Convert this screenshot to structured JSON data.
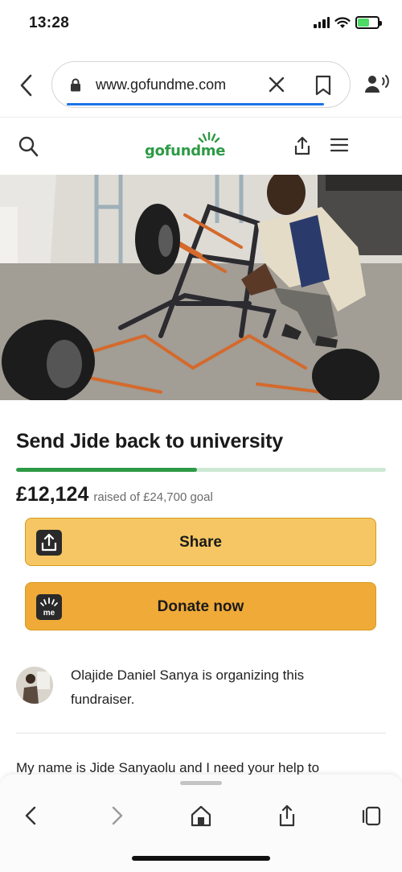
{
  "status_bar": {
    "time": "13:28",
    "icons": [
      "signal-icon",
      "wifi-icon",
      "battery-charging-icon"
    ]
  },
  "browser": {
    "url": "www.gofundme.com",
    "icons": [
      "back-icon",
      "lock-icon",
      "clear-icon",
      "bookmark-icon",
      "reader-mode-icon"
    ],
    "accent": "#1a73e8"
  },
  "site_header": {
    "logo_text": "gofundme",
    "icons": [
      "search-icon",
      "share-icon",
      "menu-icon"
    ],
    "brand_color": "#2d9a45"
  },
  "campaign": {
    "title": "Send Jide back to university",
    "raised": "£12,124",
    "goal_text": "raised of £24,700 goal",
    "progress_fraction": 0.49,
    "share_label": "Share",
    "donate_label": "Donate now",
    "donate_icon_text": "me"
  },
  "organizer": {
    "text": "Olajide Daniel Sanya is organizing this fundraiser."
  },
  "story": {
    "text": "My name is Jide Sanyaolu and I need your help to"
  },
  "bottom_toolbar": {
    "icons": [
      "back-icon",
      "forward-icon",
      "home-icon",
      "share-icon",
      "tabs-icon"
    ]
  }
}
